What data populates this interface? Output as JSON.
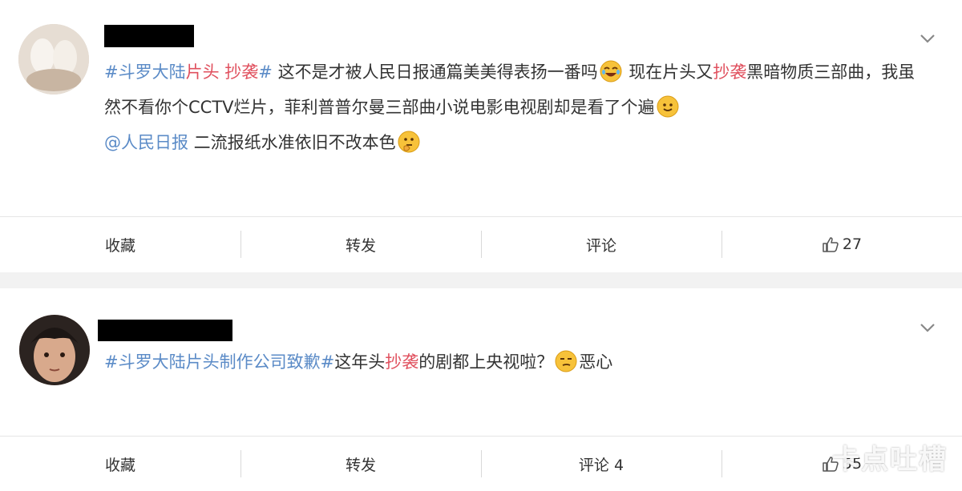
{
  "posts": [
    {
      "segments": {
        "tag1_a": "#斗罗大陆",
        "tag1_b": "片头",
        "tag1_c": " 抄袭",
        "tag1_d": "#",
        "t1": " 这不是才被人民日报通篇美美得表扬一番吗",
        "t2": " 现在片头又",
        "hl1": "抄袭",
        "t3": "黑暗物质三部曲，我虽然不看你个CCTV烂片，菲利普普尔曼三部曲小说电影电视剧却是看了个遍",
        "mention": "@人民日报",
        "t4": " 二流报纸水准依旧不改本色"
      },
      "actions": {
        "favorite": "收藏",
        "repost": "转发",
        "comment": "评论",
        "like_count": "27"
      }
    },
    {
      "segments": {
        "tag_a": "#斗罗大陆",
        "tag_b": "片头制作公司致歉#",
        "t1": "这年头",
        "hl1": "抄袭",
        "t2": "的剧都上央视啦？",
        "t3": "恶心"
      },
      "actions": {
        "favorite": "收藏",
        "repost": "转发",
        "comment": "评论 4",
        "like_count": "55"
      }
    }
  ],
  "icons": {
    "menu": "chevron-down-icon",
    "like": "thumbs-up-icon",
    "emoji_laugh": "laughing-tears-emoji",
    "emoji_smile": "smile-emoji",
    "emoji_think": "thinking-emoji",
    "emoji_smirk": "smirk-emoji"
  },
  "colors": {
    "tag": "#5b8bc7",
    "highlight": "#e0505e",
    "text": "#333333"
  },
  "watermark": "卡点吐槽"
}
